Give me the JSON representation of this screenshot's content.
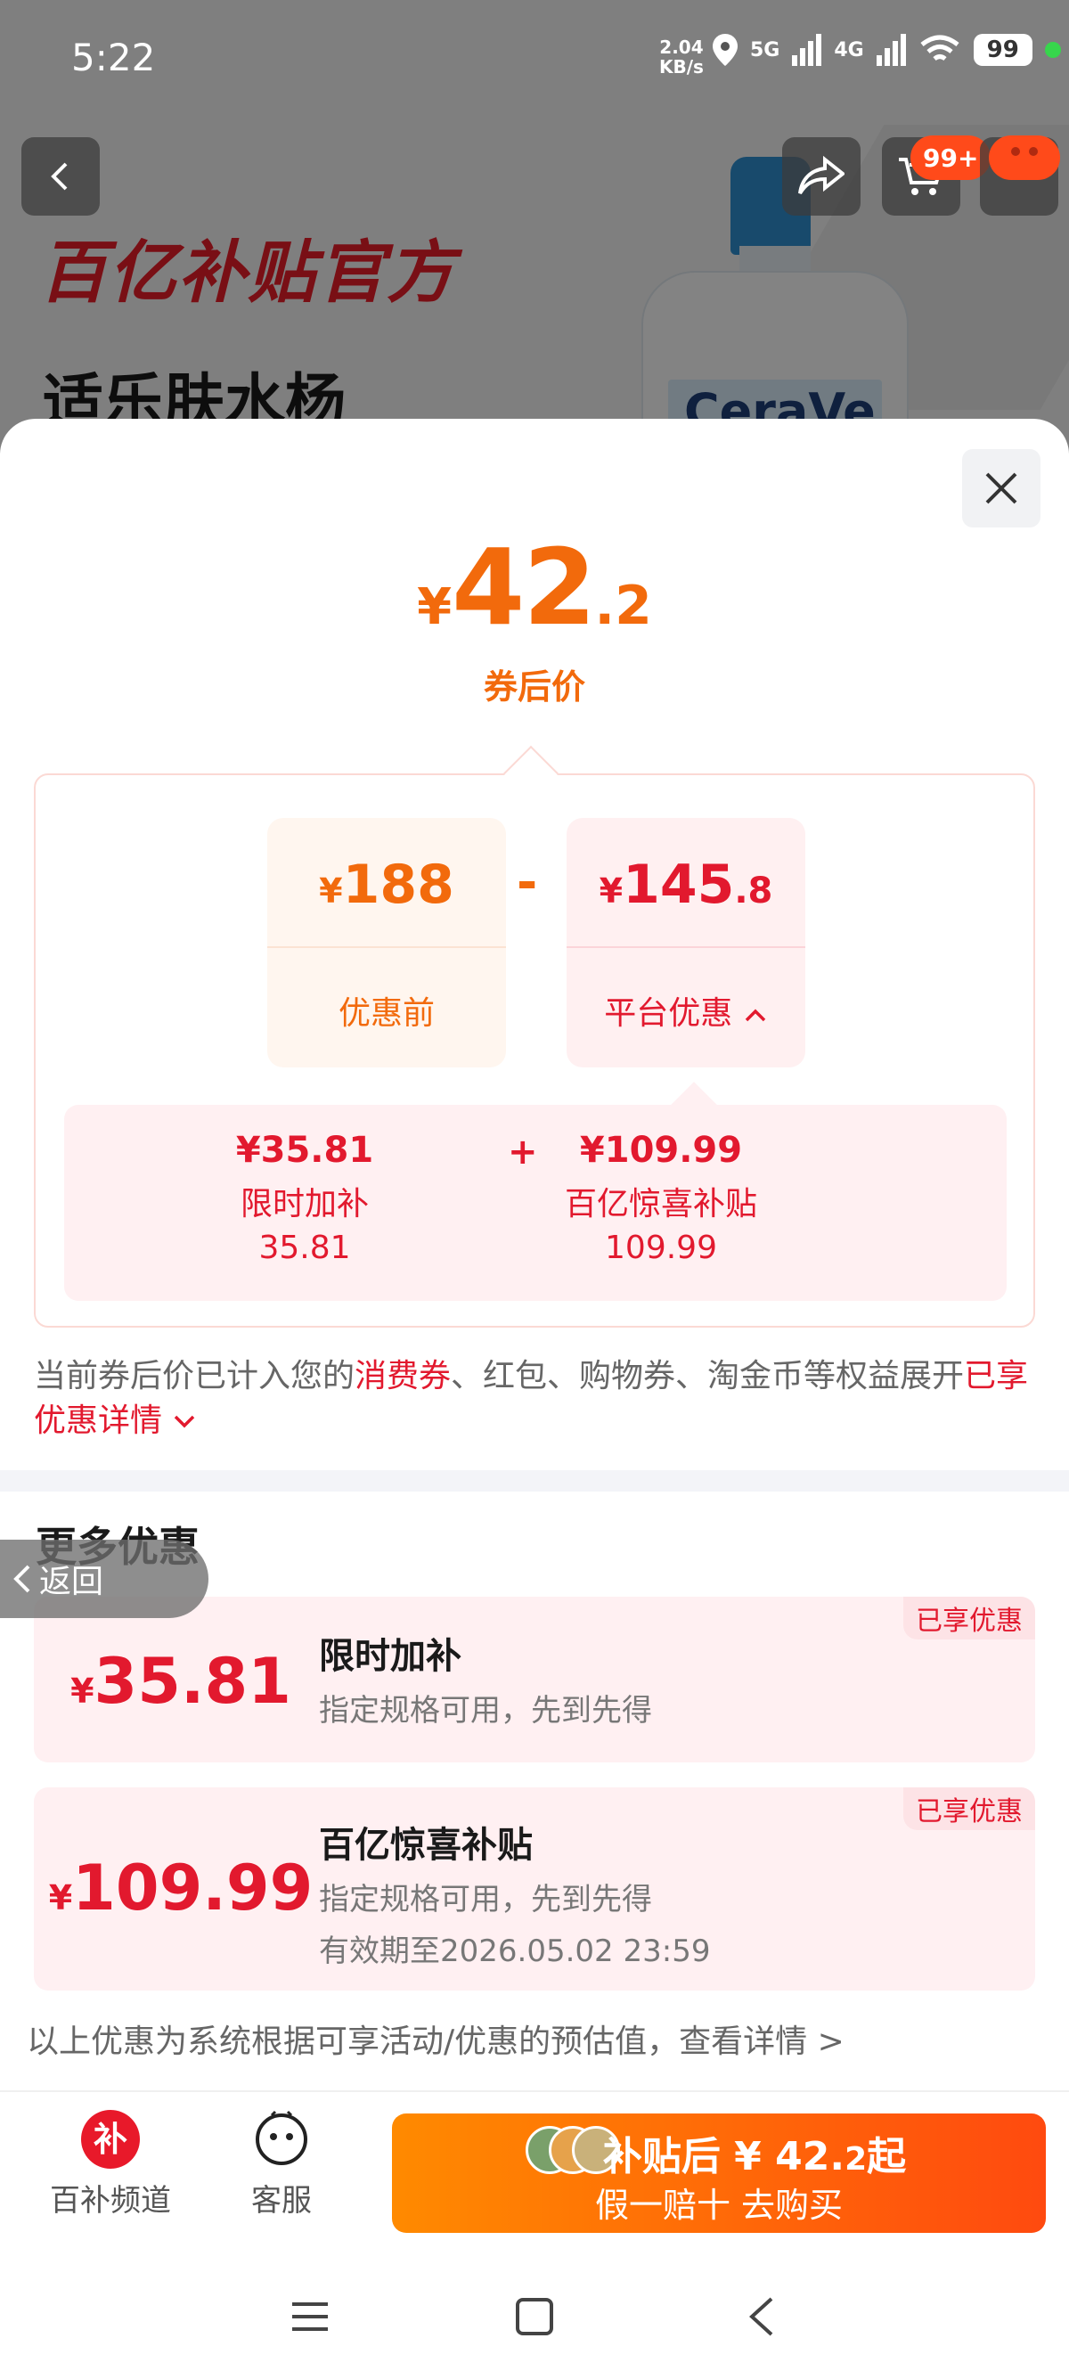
{
  "status_bar": {
    "time": "5:22",
    "net_speed_top": "2.04",
    "net_speed_bottom": "KB/s",
    "signal1": "5G",
    "signal2": "4G",
    "battery": "99"
  },
  "background_page": {
    "banner": "百亿补贴官方",
    "product_title": "适乐肤水杨",
    "bottle_brand": "CeraVe",
    "cart_badge": "99+"
  },
  "price_summary": {
    "currency": "¥",
    "price_int": "42",
    "price_dec": ".2",
    "caption": "券后价"
  },
  "calc": {
    "before": {
      "currency": "¥",
      "value": "188",
      "label": "优惠前"
    },
    "operator": "-",
    "platform": {
      "currency": "¥",
      "value_int": "145",
      "value_dec": ".8",
      "label": "平台优惠"
    },
    "plus": "+",
    "sub_items": [
      {
        "amount": "¥35.81",
        "label": "限时加补",
        "value": "35.81"
      },
      {
        "amount": "¥109.99",
        "label": "百亿惊喜补贴",
        "value": "109.99"
      }
    ]
  },
  "note": {
    "prefix": "当前券后价已计入您的",
    "highlight": "消费券",
    "suffix": "、红包、购物券、淘金币等权益展开",
    "link": "已享优惠详情"
  },
  "more_offers": {
    "title": "更多优惠",
    "back_label": "返回",
    "items": [
      {
        "currency": "¥",
        "amount": "35.81",
        "name": "限时加补",
        "desc": "指定规格可用，先到先得",
        "validity": "",
        "badge": "已享优惠"
      },
      {
        "currency": "¥",
        "amount": "109.99",
        "name": "百亿惊喜补贴",
        "desc": "指定规格可用，先到先得",
        "validity": "有效期至2026.05.02 23:59",
        "badge": "已享优惠"
      }
    ]
  },
  "disclaimer": "以上优惠为系统根据可享活动/优惠的预估值，查看详情 >",
  "bottom_bar": {
    "tab1_label": "百补频道",
    "tab1_icon_text": "补",
    "tab2_label": "客服",
    "buy_line1_prefix": "补贴后 ¥ 42.",
    "buy_line1_dec": "2",
    "buy_line1_suffix": "起",
    "buy_line2": "假一赔十  去购买"
  },
  "colors": {
    "orange": "#f26a0c",
    "red": "#e2192e",
    "pink_bg": "#fff0f2",
    "divider": "#f3f4f8"
  }
}
